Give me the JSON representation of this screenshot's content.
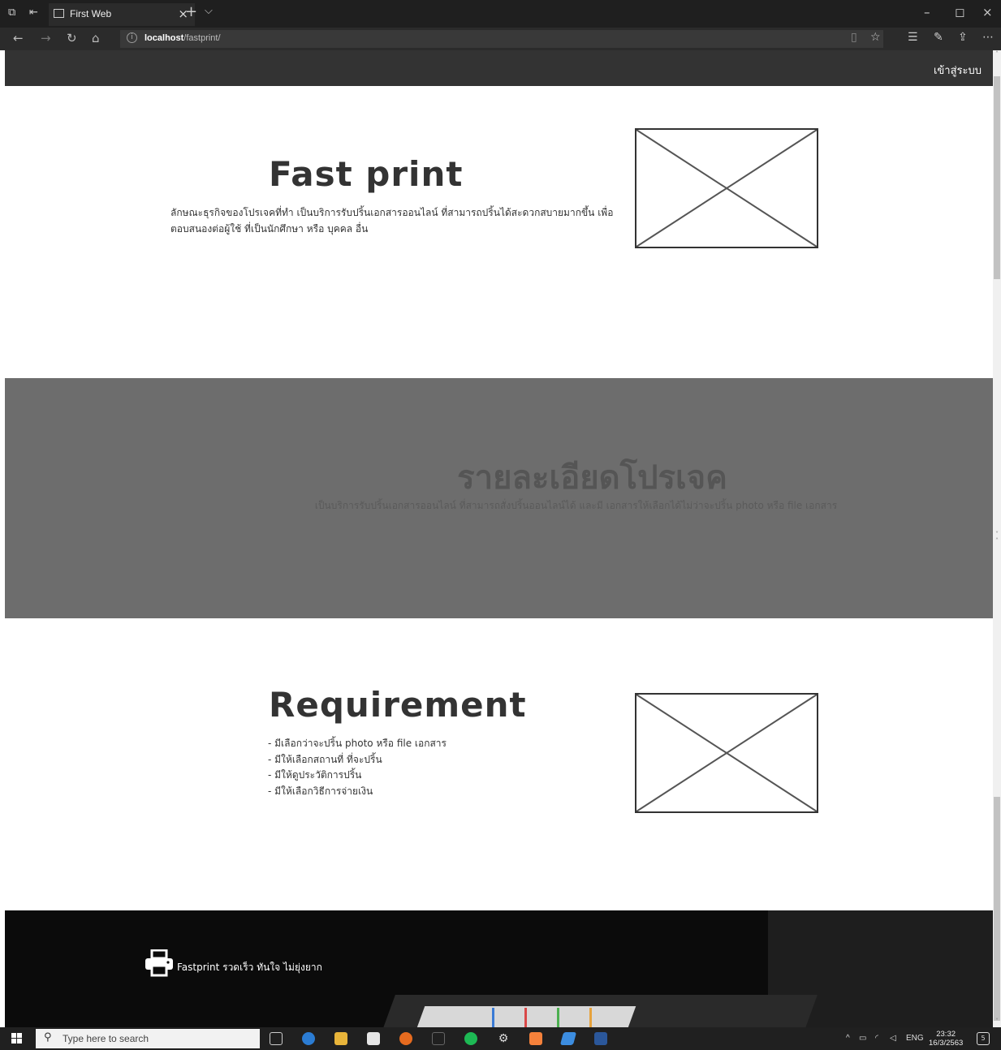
{
  "browser": {
    "tab_title": "First Web",
    "tab_close": "×",
    "new_tab": "+",
    "tab_menu": "⌵",
    "url_host": "localhost",
    "url_path": "/fastprint/",
    "window_controls": [
      "–",
      "◻",
      "×"
    ]
  },
  "nav": {
    "login_label": "เข้าสู่ระบบ"
  },
  "hero": {
    "title": "Fast print",
    "description": "ลักษณะธุรกิจของโปรเจคที่ทำ เป็นบริการรับปริ้นเอกสารออนไลน์ ที่สามารถปริ้นได้สะดวกสบายมากขึ้น เพื่อตอบสนองต่อผู้ใช้ ที่เป็นนักศึกษา หรือ บุคคล อื่น"
  },
  "details": {
    "title": "รายละเอียดโปรเจค",
    "text": "เป็นบริการรับปริ้นเอกสารออนไลน์ ที่สามารถสั่งปริ้นออนไลน์ได้ และมี เอกสารให้เลือกได้ไม่ว่าจะปริ้น photo หรือ file เอกสาร"
  },
  "requirement": {
    "title": "Requirement",
    "items": [
      "- มีเลือกว่าจะปริ้น photo หรือ file เอกสาร",
      "- มีให้เลือกสถานที่ ที่จะปริ้น",
      "- มีให้ดูประวัติการปริ้น",
      "- มีให้เลือกวิธีการจ่ายเงิน"
    ]
  },
  "footer": {
    "brand_text": "Fastprint รวดเร็ว ทันใจ ไม่ยุ่งยาก",
    "icon": "printer-icon"
  },
  "taskbar": {
    "search_placeholder": "Type here to search",
    "language": "ENG",
    "time": "23:32",
    "date": "16/3/2563",
    "notification_count": "5"
  }
}
